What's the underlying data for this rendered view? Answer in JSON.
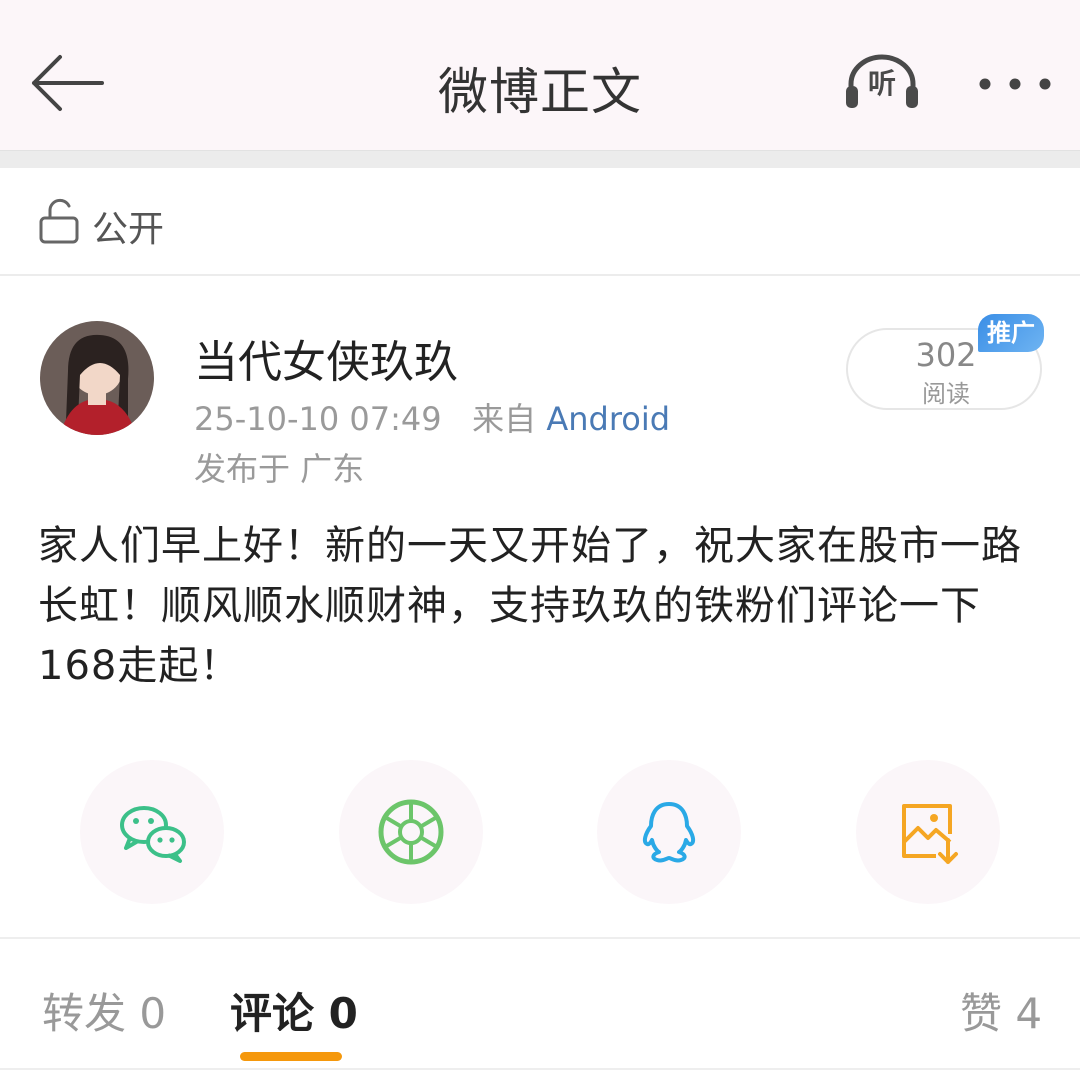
{
  "header": {
    "title": "微博正文",
    "listen_label": "听"
  },
  "visibility": {
    "label": "公开"
  },
  "post": {
    "author": "当代女侠玖玖",
    "time": "25-10-10 07:49",
    "source_prefix": "来自",
    "source": "Android",
    "location": "发布于 广东",
    "reads_count": "302",
    "reads_label": "阅读",
    "promo_badge": "推广",
    "text": "家人们早上好！新的一天又开始了，祝大家在股市一路长虹！顺风顺水顺财神，支持玖玖的铁粉们评论一下168走起！"
  },
  "share": [
    {
      "name": "wechat",
      "icon": "wechat-icon",
      "color": "#3cc089"
    },
    {
      "name": "moments",
      "icon": "moments-icon",
      "color": "#6cc56a"
    },
    {
      "name": "qq",
      "icon": "qq-icon",
      "color": "#2aa9e6"
    },
    {
      "name": "save-image",
      "icon": "save-image-icon",
      "color": "#f5a623"
    }
  ],
  "tabs": {
    "repost": "转发 0",
    "comment": "评论 0",
    "like": "赞 4",
    "active_color": "#f5980c"
  }
}
